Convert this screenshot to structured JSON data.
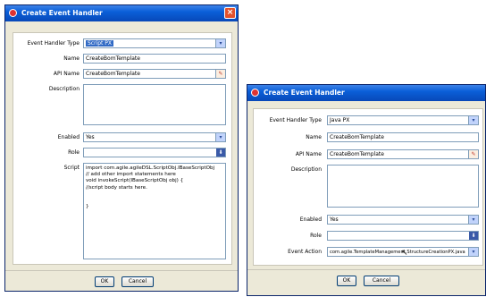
{
  "left": {
    "title": "Create Event Handler",
    "labels": {
      "type": "Event Handler Type",
      "name": "Name",
      "api": "API Name",
      "desc": "Description",
      "enabled": "Enabled",
      "role": "Role",
      "script": "Script"
    },
    "values": {
      "type": "Script PX",
      "name": "CreateBomTemplate",
      "api": "CreateBomTemplate",
      "enabled": "Yes"
    },
    "script_lines": [
      "import com.agile.agileDSL.ScriptObj.IBaseScriptObj",
      "// add other import statements here",
      "void invokeScript(IBaseScriptObj obj) {",
      "//script body starts here.",
      "",
      "",
      "}"
    ],
    "ok": "OK",
    "cancel": "Cancel"
  },
  "right": {
    "title": "Create Event Handler",
    "labels": {
      "type": "Event Handler Type",
      "name": "Name",
      "api": "API Name",
      "desc": "Description",
      "enabled": "Enabled",
      "role": "Role",
      "action": "Event Action"
    },
    "values": {
      "type": "Java PX",
      "name": "CreateBomTemplate",
      "api": "CreateBomTemplate",
      "enabled": "Yes",
      "action": "com.agile.TemplateManagement.StructureCreationPX.java"
    },
    "ok": "OK",
    "cancel": "Cancel"
  },
  "icons": {
    "close": "×",
    "dropdown": "▾",
    "picker": "✎",
    "role_picker": "⬇"
  }
}
